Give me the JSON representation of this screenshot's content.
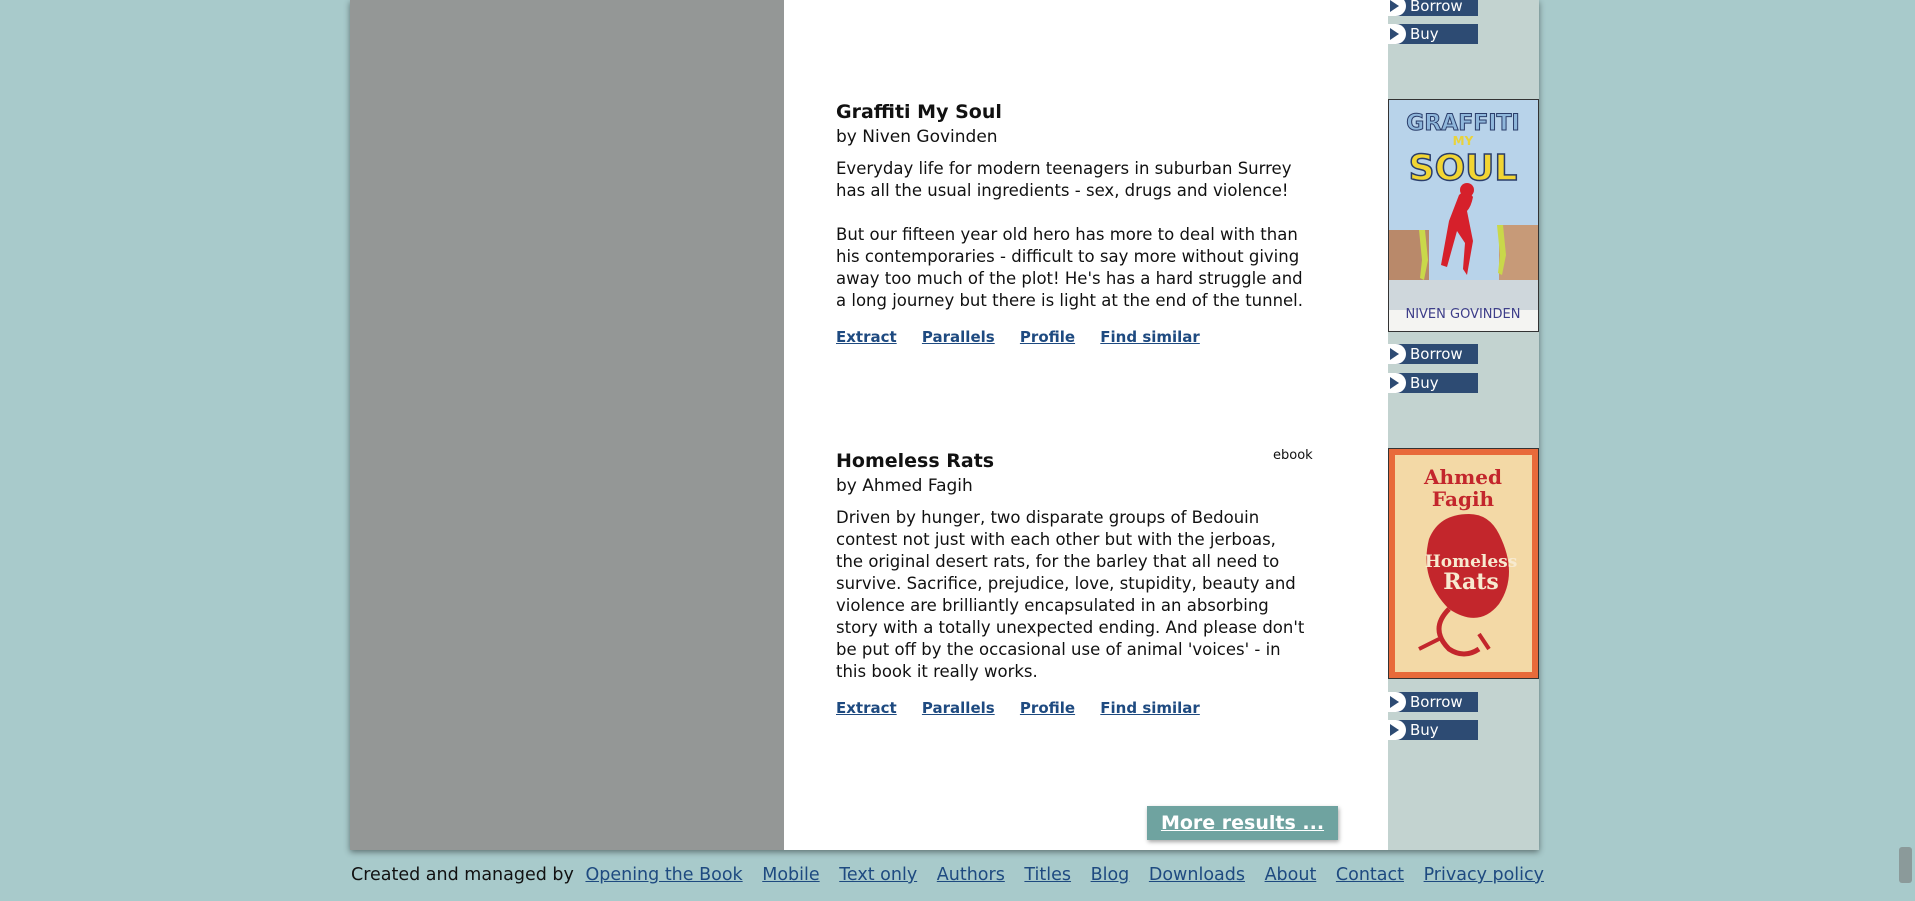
{
  "books": [
    {
      "title": "Graffiti My Soul",
      "author": "by Niven Govinden",
      "description": [
        "Everyday life for modern teenagers in suburban Surrey has all the usual ingredients - sex, drugs and violence!",
        "But our fifteen year old hero has more to deal with than his contemporaries - difficult to say more without giving away too much of the plot! He's has a hard struggle and a long journey but there is light at the end of the tunnel."
      ],
      "format": "",
      "cover": {
        "line1": "GRAFFITI",
        "line2": "MY",
        "line3": "SOUL",
        "author_caption": "NIVEN GOVINDEN"
      }
    },
    {
      "title": "Homeless Rats",
      "author": "by Ahmed Fagih",
      "description": [
        "Driven by hunger, two disparate groups of Bedouin contest not just with each other but with the jerboas, the original desert rats, for the barley that all need to survive. Sacrifice, prejudice, love, stupidity, beauty and violence are brilliantly encapsulated in an absorbing story with a totally unexpected ending. And please don't be put off by the occasional use of animal 'voices' - in this book it really works."
      ],
      "format": "ebook",
      "cover": {
        "author_line1": "Ahmed",
        "author_line2": "Fagih",
        "title_line1": "Homeless",
        "title_line2": "Rats"
      }
    }
  ],
  "book_links": {
    "extract": "Extract",
    "parallels": "Parallels",
    "profile": "Profile",
    "find_similar": "Find similar"
  },
  "buttons": {
    "borrow": "Borrow",
    "buy": "Buy"
  },
  "more_results": "More results ...",
  "footer": {
    "credit": "Created and managed by",
    "links": [
      "Opening the Book",
      "Mobile",
      "Text only",
      "Authors",
      "Titles",
      "Blog",
      "Downloads",
      "About",
      "Contact",
      "Privacy policy"
    ]
  },
  "colors": {
    "page_bg": "#a8cacb",
    "left_column": "#949796",
    "right_column": "#c3d3d0",
    "button": "#2d4b73",
    "link": "#1e4a80",
    "more_button": "#6fa3a0"
  }
}
